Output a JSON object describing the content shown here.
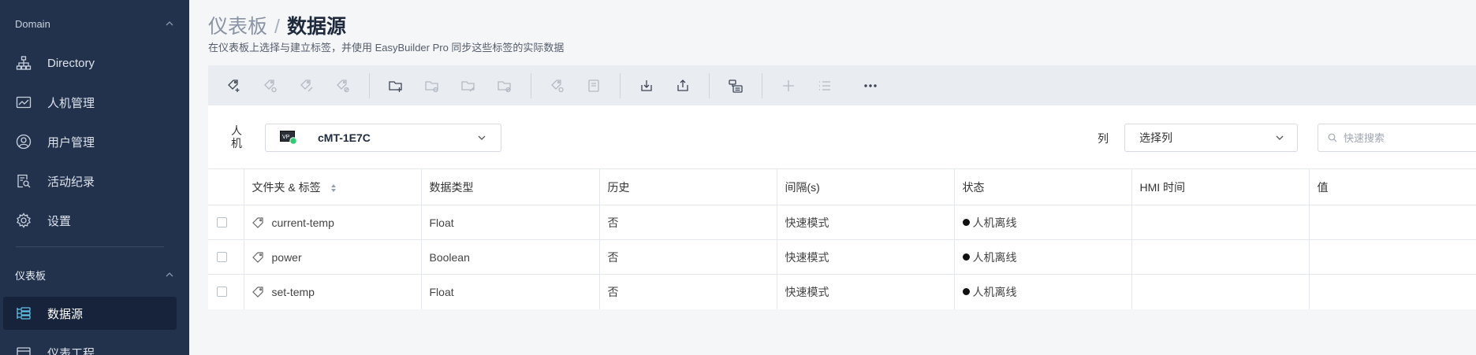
{
  "sidebar": {
    "domain_header": "Domain",
    "domain_items": [
      {
        "label": "Directory",
        "icon": "sitemap-icon"
      },
      {
        "label": "人机管理",
        "icon": "monitor-icon"
      },
      {
        "label": "用户管理",
        "icon": "user-circle-icon"
      },
      {
        "label": "活动纪录",
        "icon": "log-search-icon"
      },
      {
        "label": "设置",
        "icon": "gear-icon"
      }
    ],
    "dashboard_header": "仪表板",
    "dashboard_items": [
      {
        "label": "数据源",
        "icon": "datasource-icon",
        "active": true
      },
      {
        "label": "仪表工程",
        "icon": "project-icon"
      }
    ]
  },
  "header": {
    "breadcrumb_parent": "仪表板",
    "breadcrumb_separator": "/",
    "breadcrumb_current": "数据源",
    "subtitle": "在仪表板上选择与建立标签，并使用 EasyBuilder Pro 同步这些标签的实际数据"
  },
  "filters": {
    "hmi_label": "人机",
    "hmi_value": "cMT-1E7C",
    "columns_label": "列",
    "columns_value": "选择列",
    "search_placeholder": "快速搜索"
  },
  "table": {
    "headers": [
      "文件夹 & 标签",
      "数据类型",
      "历史",
      "间隔(s)",
      "状态",
      "HMI 时间",
      "值"
    ],
    "rows": [
      {
        "name": "current-temp",
        "type": "Float",
        "history": "否",
        "interval": "快速模式",
        "status": "人机离线",
        "hmi_time": "",
        "value": ""
      },
      {
        "name": "power",
        "type": "Boolean",
        "history": "否",
        "interval": "快速模式",
        "status": "人机离线",
        "hmi_time": "",
        "value": ""
      },
      {
        "name": "set-temp",
        "type": "Float",
        "history": "否",
        "interval": "快速模式",
        "status": "人机离线",
        "hmi_time": "",
        "value": ""
      }
    ]
  },
  "colors": {
    "sidebar_bg": "#22324d",
    "online_dot": "#2ecc71",
    "offline_dot": "#111111"
  }
}
